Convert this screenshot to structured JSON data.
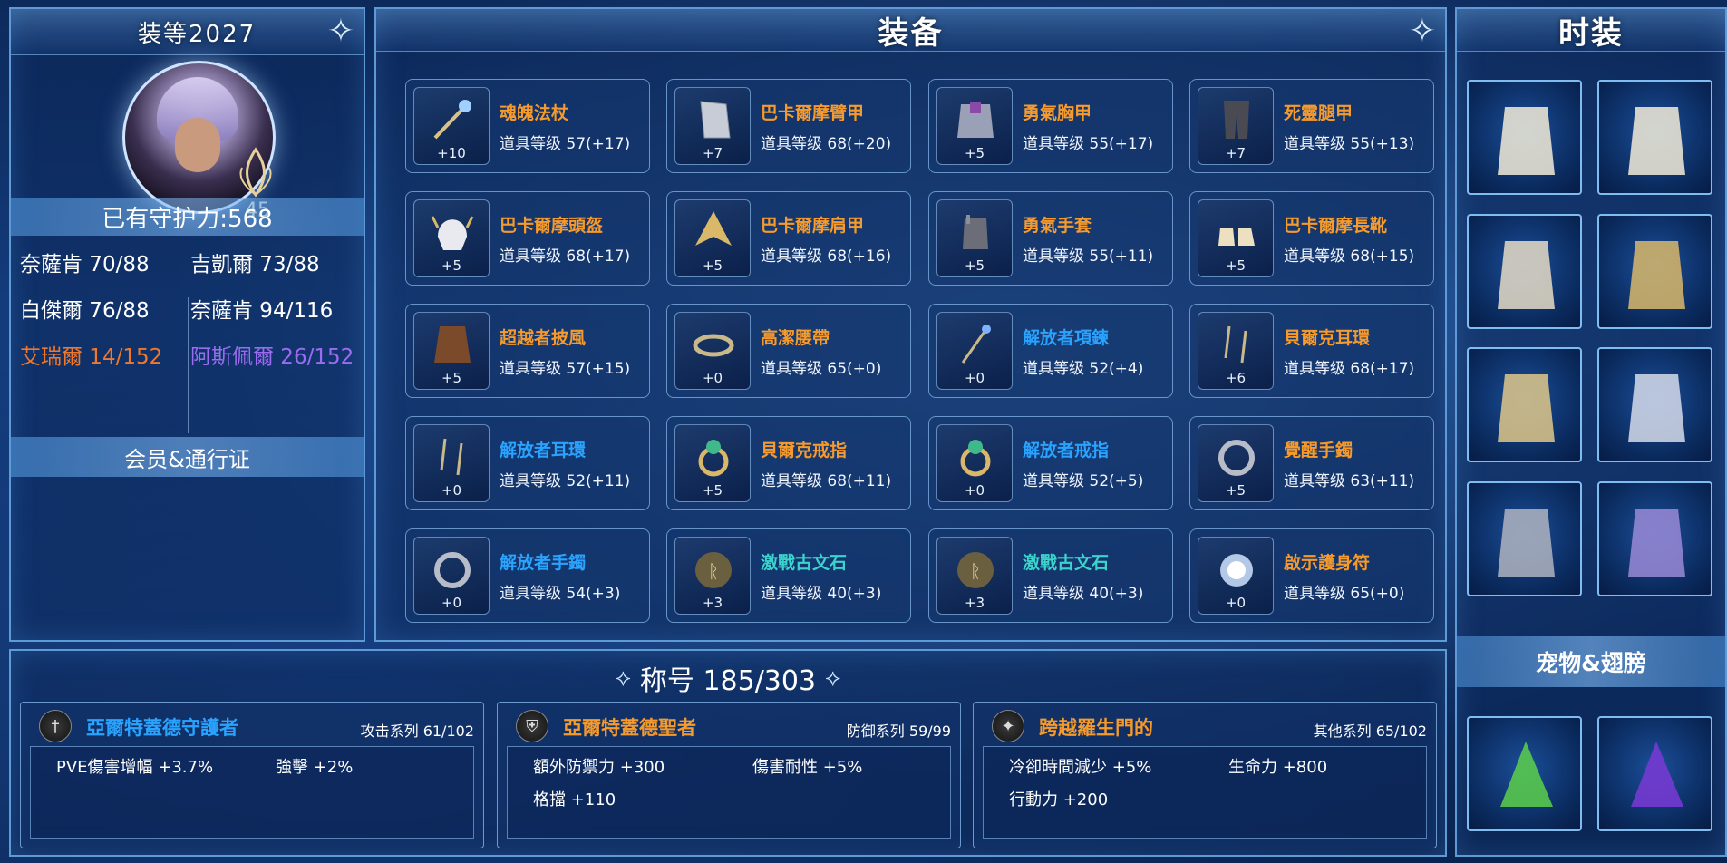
{
  "left_panel": {
    "gear_score": "装等2027",
    "avatar_level": "45",
    "guardian_power": "已有守护力:568",
    "stats": [
      {
        "label": "奈薩肯 70/88"
      },
      {
        "label": "吉凱爾 73/88"
      },
      {
        "label": "白傑爾 76/88"
      },
      {
        "label": "奈薩肯 94/116"
      },
      {
        "label": "艾瑞爾 14/152"
      },
      {
        "label": "阿斯佩爾 26/152"
      }
    ],
    "membership": "会员&通行证",
    "colors": {
      "orange": "#f0782c",
      "purple": "#9a6cf0"
    }
  },
  "equipment": {
    "title": "装备",
    "items": [
      {
        "name": "魂魄法杖",
        "stat": "道具等级 57(+17)",
        "enhance": "+10",
        "color": "orange",
        "icon": "staff-icon"
      },
      {
        "name": "巴卡爾摩臂甲",
        "stat": "道具等级 68(+20)",
        "enhance": "+7",
        "color": "orange",
        "icon": "armguard-icon"
      },
      {
        "name": "勇氣胸甲",
        "stat": "道具等级 55(+17)",
        "enhance": "+5",
        "color": "orange",
        "icon": "chestplate-icon"
      },
      {
        "name": "死靈腿甲",
        "stat": "道具等级 55(+13)",
        "enhance": "+7",
        "color": "orange",
        "icon": "leggings-icon"
      },
      {
        "name": "巴卡爾摩頭盔",
        "stat": "道具等级 68(+17)",
        "enhance": "+5",
        "color": "orange",
        "icon": "helmet-icon"
      },
      {
        "name": "巴卡爾摩肩甲",
        "stat": "道具等级 68(+16)",
        "enhance": "+5",
        "color": "orange",
        "icon": "shoulder-icon"
      },
      {
        "name": "勇氣手套",
        "stat": "道具等级 55(+11)",
        "enhance": "+5",
        "color": "orange",
        "icon": "gloves-icon"
      },
      {
        "name": "巴卡爾摩長靴",
        "stat": "道具等级 68(+15)",
        "enhance": "+5",
        "color": "orange",
        "icon": "boots-icon"
      },
      {
        "name": "超越者披風",
        "stat": "道具等级 57(+15)",
        "enhance": "+5",
        "color": "orange",
        "icon": "cape-icon"
      },
      {
        "name": "高潔腰帶",
        "stat": "道具等级 65(+0)",
        "enhance": "+0",
        "color": "orange",
        "icon": "belt-icon"
      },
      {
        "name": "解放者項鍊",
        "stat": "道具等级 52(+4)",
        "enhance": "+0",
        "color": "blue",
        "icon": "necklace-icon"
      },
      {
        "name": "貝爾克耳環",
        "stat": "道具等级 68(+17)",
        "enhance": "+6",
        "color": "orange",
        "icon": "earring-icon"
      },
      {
        "name": "解放者耳環",
        "stat": "道具等级 52(+11)",
        "enhance": "+0",
        "color": "blue",
        "icon": "earring-icon"
      },
      {
        "name": "貝爾克戒指",
        "stat": "道具等级 68(+11)",
        "enhance": "+5",
        "color": "orange",
        "icon": "ring-icon"
      },
      {
        "name": "解放者戒指",
        "stat": "道具等级 52(+5)",
        "enhance": "+0",
        "color": "blue",
        "icon": "ring-icon"
      },
      {
        "name": "覺醒手鐲",
        "stat": "道具等级 63(+11)",
        "enhance": "+5",
        "color": "orange",
        "icon": "bracelet-icon"
      },
      {
        "name": "解放者手鐲",
        "stat": "道具等级 54(+3)",
        "enhance": "+0",
        "color": "blue",
        "icon": "bracelet-icon"
      },
      {
        "name": "激戰古文石",
        "stat": "道具等级 40(+3)",
        "enhance": "+3",
        "color": "cyan",
        "icon": "rune-stone-icon"
      },
      {
        "name": "激戰古文石",
        "stat": "道具等级 40(+3)",
        "enhance": "+3",
        "color": "cyan",
        "icon": "rune-stone-icon"
      },
      {
        "name": "啟示護身符",
        "stat": "道具等级 65(+0)",
        "enhance": "+0",
        "color": "orange",
        "icon": "amulet-icon"
      }
    ]
  },
  "fashion": {
    "title": "时装",
    "slots": [
      "costume-top-icon",
      "costume-boots-icon",
      "costume-sleeve-icon",
      "costume-feather-icon",
      "costume-glove-icon",
      "costume-skirt-icon",
      "costume-weapon-icon",
      "costume-hood-icon"
    ],
    "pet_wings_label": "宠物&翅膀",
    "pet_slots": [
      "pet-icon",
      "wings-icon"
    ]
  },
  "titles": {
    "header": "称号 185/303",
    "cards": [
      {
        "name": "亞爾特蓋德守護者",
        "series": "攻击系列 61/102",
        "color": "blue",
        "icon": "sword-badge-icon",
        "stats": [
          "PVE傷害增幅 +3.7%",
          "強擊 +2%"
        ]
      },
      {
        "name": "亞爾特蓋德聖者",
        "series": "防御系列 59/99",
        "color": "orange",
        "icon": "shield-badge-icon",
        "stats": [
          "額外防禦力 +300",
          "傷害耐性 +5%",
          "格擋 +110"
        ]
      },
      {
        "name": "跨越羅生門的",
        "series": "其他系列 65/102",
        "color": "orange",
        "icon": "star-badge-icon",
        "stats": [
          "冷卻時間減少 +5%",
          "生命力 +800",
          "行動力 +200"
        ]
      }
    ]
  }
}
